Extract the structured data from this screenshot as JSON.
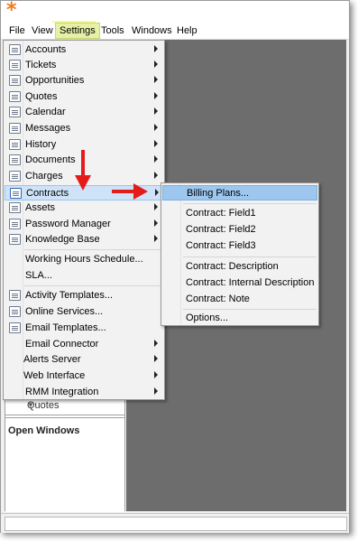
{
  "app": {
    "icon": "asterisk-logo-icon",
    "accent": "#f07a1a"
  },
  "menubar": {
    "items": [
      {
        "label": "File"
      },
      {
        "label": "View"
      },
      {
        "label": "Settings"
      },
      {
        "label": "Tools"
      },
      {
        "label": "Windows"
      },
      {
        "label": "Help"
      }
    ],
    "highlight_color": "#f4f98a"
  },
  "settings_menu": {
    "items": [
      {
        "label": "Accounts",
        "icon": "accounts-icon",
        "submenu": true
      },
      {
        "label": "Tickets",
        "icon": "tickets-icon",
        "submenu": true
      },
      {
        "label": "Opportunities",
        "icon": "opportunities-icon",
        "submenu": true
      },
      {
        "label": "Quotes",
        "icon": "quotes-icon",
        "submenu": true
      },
      {
        "label": "Calendar",
        "icon": "calendar-icon",
        "submenu": true
      },
      {
        "label": "Messages",
        "icon": "messages-icon",
        "submenu": true
      },
      {
        "label": "History",
        "icon": "history-icon",
        "submenu": true
      },
      {
        "label": "Documents",
        "icon": "documents-icon",
        "submenu": true
      },
      {
        "label": "Charges",
        "icon": "charges-icon",
        "submenu": true
      },
      {
        "label": "Contracts",
        "icon": "contracts-icon",
        "submenu": true,
        "selected": true
      },
      {
        "label": "Assets",
        "icon": "assets-icon",
        "submenu": true
      },
      {
        "label": "Password Manager",
        "icon": "lock-icon",
        "submenu": true
      },
      {
        "label": "Knowledge Base",
        "icon": "book-icon",
        "submenu": true
      },
      {
        "label": "Working Hours Schedule..."
      },
      {
        "label": "SLA..."
      },
      {
        "label": "Activity Templates...",
        "icon": "templates-icon"
      },
      {
        "label": "Online Services...",
        "icon": "rss-icon"
      },
      {
        "label": "Email Templates...",
        "icon": "email-icon"
      },
      {
        "label": "Email Connector",
        "submenu": true
      },
      {
        "label": "Alerts Server",
        "submenu": true
      },
      {
        "label": "Web Interface",
        "submenu": true
      },
      {
        "label": "RMM Integration",
        "submenu": true
      }
    ]
  },
  "contracts_submenu": {
    "items": [
      {
        "label": "Billing Plans...",
        "selected": true
      },
      {
        "label": "Contract: Field1"
      },
      {
        "label": "Contract: Field2"
      },
      {
        "label": "Contract: Field3"
      },
      {
        "label": "Contract: Description"
      },
      {
        "label": "Contract: Internal Description"
      },
      {
        "label": "Contract: Note"
      },
      {
        "label": "Options..."
      }
    ]
  },
  "left_pane": {
    "combo_value": "Quotes",
    "open_windows_label": "Open Windows"
  },
  "annotation_arrow_color": "#e31b1b"
}
